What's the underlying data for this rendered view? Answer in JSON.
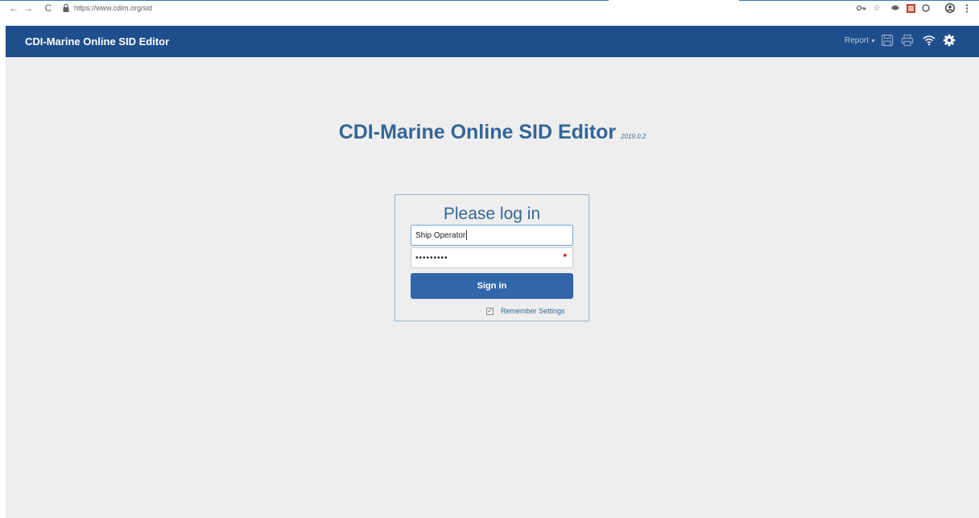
{
  "browser": {
    "url": "https://www.cdim.org/sid",
    "nav": {
      "back": "←",
      "forward": "→",
      "reload": "C"
    },
    "extensions": [
      "key-icon",
      "star-icon",
      "extension-icon",
      "pdf-icon",
      "circle-icon",
      "profile-icon",
      "menu-icon"
    ]
  },
  "navbar": {
    "brand": "CDI-Marine Online SID Editor",
    "report_label": "Report",
    "icons": [
      "save-icon",
      "print-icon",
      "wifi-icon",
      "settings-icon"
    ]
  },
  "hero": {
    "title": "CDI-Marine Online SID Editor",
    "version": "2019.0.2"
  },
  "login": {
    "heading": "Please log in",
    "username_value": "Ship Operator",
    "password_mask": "•••••••••",
    "required_mark": "*",
    "signin_label": "Sign in",
    "remember_label": "Remember Settings",
    "remember_checked": true
  },
  "colors": {
    "navbar_bg": "#1f4e8c",
    "accent": "#336699",
    "button": "#3266aa",
    "page_bg": "#eeeeee"
  }
}
